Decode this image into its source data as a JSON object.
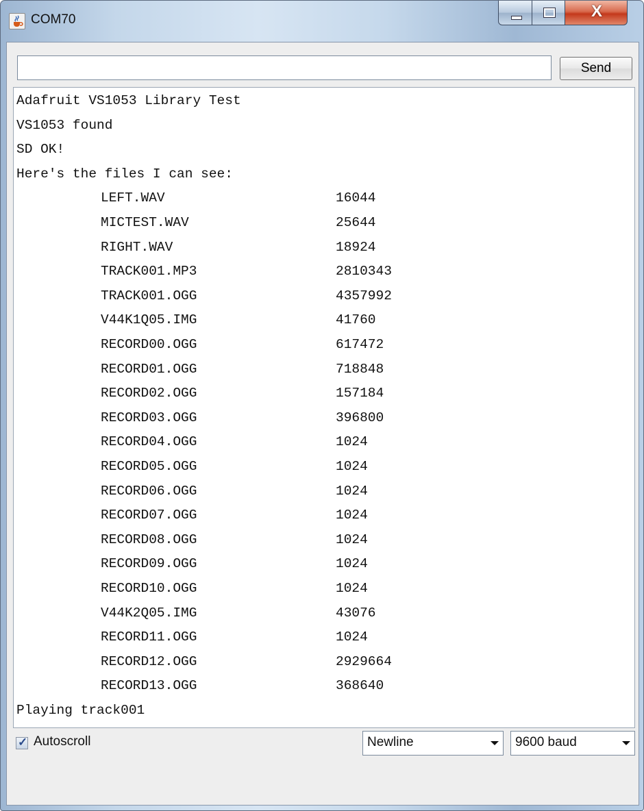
{
  "window": {
    "title": "COM70"
  },
  "toolbar": {
    "input_value": "",
    "send_label": "Send"
  },
  "output": {
    "header_lines": [
      "Adafruit VS1053 Library Test",
      "VS1053 found",
      "SD OK!",
      "Here's the files I can see:"
    ],
    "files": [
      {
        "name": "LEFT.WAV",
        "size": "16044"
      },
      {
        "name": "MICTEST.WAV",
        "size": "25644"
      },
      {
        "name": "RIGHT.WAV",
        "size": "18924"
      },
      {
        "name": "TRACK001.MP3",
        "size": "2810343"
      },
      {
        "name": "TRACK001.OGG",
        "size": "4357992"
      },
      {
        "name": "V44K1Q05.IMG",
        "size": "41760"
      },
      {
        "name": "RECORD00.OGG",
        "size": "617472"
      },
      {
        "name": "RECORD01.OGG",
        "size": "718848"
      },
      {
        "name": "RECORD02.OGG",
        "size": "157184"
      },
      {
        "name": "RECORD03.OGG",
        "size": "396800"
      },
      {
        "name": "RECORD04.OGG",
        "size": "1024"
      },
      {
        "name": "RECORD05.OGG",
        "size": "1024"
      },
      {
        "name": "RECORD06.OGG",
        "size": "1024"
      },
      {
        "name": "RECORD07.OGG",
        "size": "1024"
      },
      {
        "name": "RECORD08.OGG",
        "size": "1024"
      },
      {
        "name": "RECORD09.OGG",
        "size": "1024"
      },
      {
        "name": "RECORD10.OGG",
        "size": "1024"
      },
      {
        "name": "V44K2Q05.IMG",
        "size": "43076"
      },
      {
        "name": "RECORD11.OGG",
        "size": "1024"
      },
      {
        "name": "RECORD12.OGG",
        "size": "2929664"
      },
      {
        "name": "RECORD13.OGG",
        "size": "368640"
      }
    ],
    "footer_line": "Playing track001"
  },
  "status": {
    "autoscroll_label": "Autoscroll",
    "autoscroll_checked": true,
    "line_ending": "Newline",
    "baud_rate": "9600 baud"
  },
  "icons": {
    "app": "java-cup-icon",
    "minimize": "minimize-icon",
    "maximize": "maximize-icon",
    "close": "close-icon",
    "dropdown": "chevron-down-icon"
  }
}
